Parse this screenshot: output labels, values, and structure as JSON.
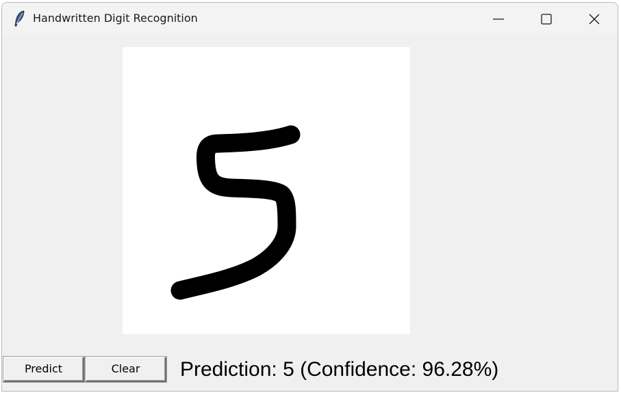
{
  "window": {
    "title": "Handwritten Digit Recognition",
    "icon": "feather-icon",
    "controls": [
      "minimize-icon",
      "maximize-icon",
      "close-icon"
    ]
  },
  "canvas": {
    "drawn_digit": "5",
    "background": "#ffffff",
    "stroke_color": "#000000"
  },
  "buttons": {
    "predict_label": "Predict",
    "clear_label": "Clear"
  },
  "result": {
    "text": "Prediction: 5 (Confidence: 96.28%)"
  }
}
